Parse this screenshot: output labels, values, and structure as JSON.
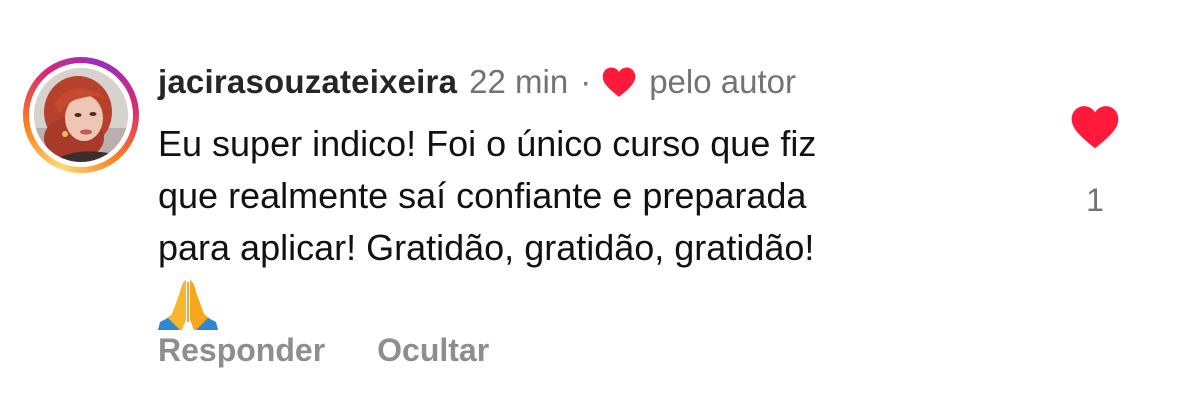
{
  "comment": {
    "username": "jacirasouzateixeira",
    "time": "22 min",
    "separator": "·",
    "liked_by_author_label": "pelo autor",
    "text_lines": [
      "Eu super indico! Foi o único curso que fiz",
      "que realmente saí confiante e preparada",
      "para aplicar! Gratidão, gratidão, gratidão!"
    ],
    "emoji": "praying-hands",
    "like_count": "1",
    "liked": true
  },
  "actions": {
    "reply_label": "Responder",
    "hide_label": "Ocultar"
  },
  "icons": {
    "author_heart": "heart-icon",
    "like_button": "heart-icon",
    "emoji": "praying-hands-icon"
  },
  "colors": {
    "heart": "#ff1a3c",
    "username": "#262626",
    "meta": "#737373",
    "action": "#8e8e8e",
    "text": "#111111"
  }
}
